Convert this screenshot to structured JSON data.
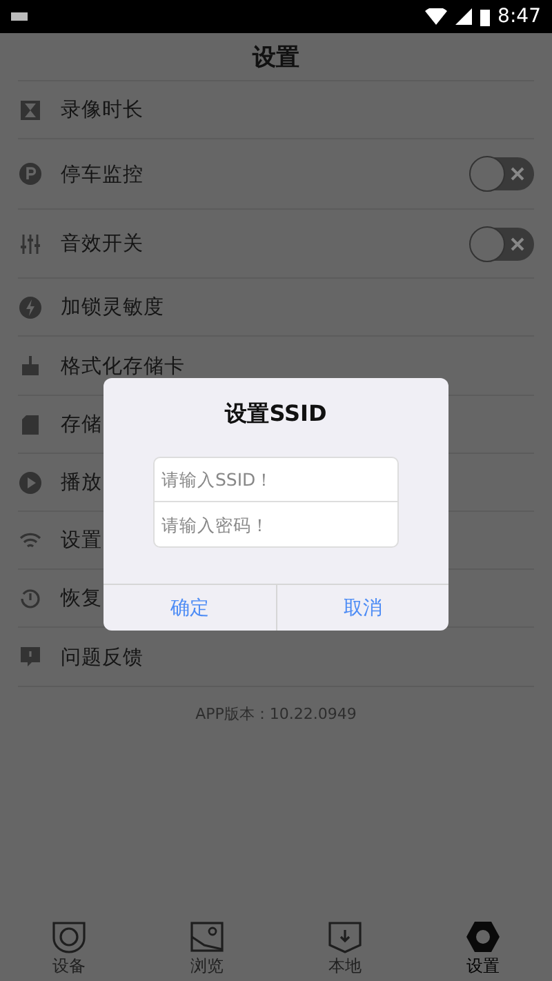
{
  "status_bar": {
    "time": "8:47"
  },
  "header": {
    "title": "设置"
  },
  "settings": [
    {
      "label": "录像时长",
      "kind": "plain"
    },
    {
      "label": "停车监控",
      "kind": "toggle",
      "on": false
    },
    {
      "label": "音效开关",
      "kind": "toggle",
      "on": false
    },
    {
      "label": "加锁灵敏度",
      "kind": "plain"
    },
    {
      "label": "格式化存储卡",
      "kind": "plain"
    },
    {
      "label": "存储",
      "kind": "plain"
    },
    {
      "label": "播放",
      "kind": "plain"
    },
    {
      "label": "设置",
      "kind": "plain"
    },
    {
      "label": "恢复",
      "kind": "plain"
    },
    {
      "label": "问题反馈",
      "kind": "plain"
    }
  ],
  "version": "APP版本：10.22.0949",
  "dialog": {
    "title": "设置SSID",
    "fields": [
      {
        "placeholder": "请输入SSID！"
      },
      {
        "placeholder": "请输入密码！"
      }
    ],
    "buttons": [
      "确定",
      "取消"
    ]
  },
  "tabs": [
    {
      "label": "设备",
      "selected": false
    },
    {
      "label": "浏览",
      "selected": false
    },
    {
      "label": "本地",
      "selected": false
    },
    {
      "label": "设置",
      "selected": true
    }
  ]
}
